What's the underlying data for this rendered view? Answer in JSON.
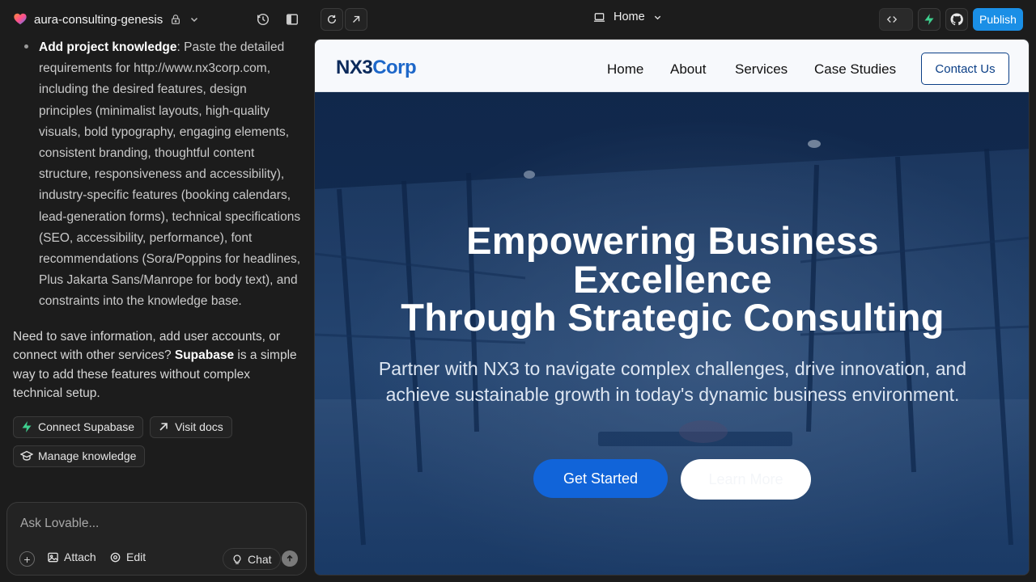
{
  "header": {
    "project_name": "aura-consulting-genesis"
  },
  "chat": {
    "bullet": {
      "bold": "Add project knowledge",
      "text": ": Paste the detailed requirements for http://www.nx3corp.com, including the desired features, design principles (minimalist layouts, high-quality visuals, bold typography, engaging elements, consistent branding, thoughtful content structure, responsiveness and accessibility), industry-specific features (booking calendars, lead-generation forms), technical specifications (SEO, accessibility, performance), font recommendations (Sora/Poppins for headlines, Plus Jakarta Sans/Manrope for body text), and constraints into the knowledge base."
    },
    "supabase_para": {
      "before": "Need to save information, add user accounts, or connect with other services? ",
      "bold": "Supabase",
      "after": " is a simple way to add these features without complex technical setup."
    },
    "chips": {
      "connect_supabase": "Connect Supabase",
      "visit_docs": "Visit docs",
      "manage_knowledge": "Manage knowledge"
    }
  },
  "composer": {
    "placeholder": "Ask Lovable...",
    "attach": "Attach",
    "edit": "Edit",
    "chat": "Chat"
  },
  "toolbar": {
    "route": "Home",
    "publish": "Publish"
  },
  "site": {
    "logo_part1": "NX3",
    "logo_part2": "Corp",
    "nav": [
      "Home",
      "About",
      "Services",
      "Case Studies"
    ],
    "contact": "Contact Us",
    "hero_title_lines": [
      "Empowering Business",
      "Excellence",
      "Through Strategic Consulting"
    ],
    "hero_subtitle": "Partner with NX3 to navigate complex challenges, drive innovation, and achieve sustainable growth in today's dynamic business environment.",
    "cta_primary": "Get Started",
    "cta_secondary": "Learn More"
  },
  "colors": {
    "accent_blue": "#1a8fe6",
    "supabase_green": "#3ecf8e",
    "brand_navy": "#0b2a5b",
    "brand_blue": "#1d67c9",
    "cta_blue": "#1164d9"
  }
}
